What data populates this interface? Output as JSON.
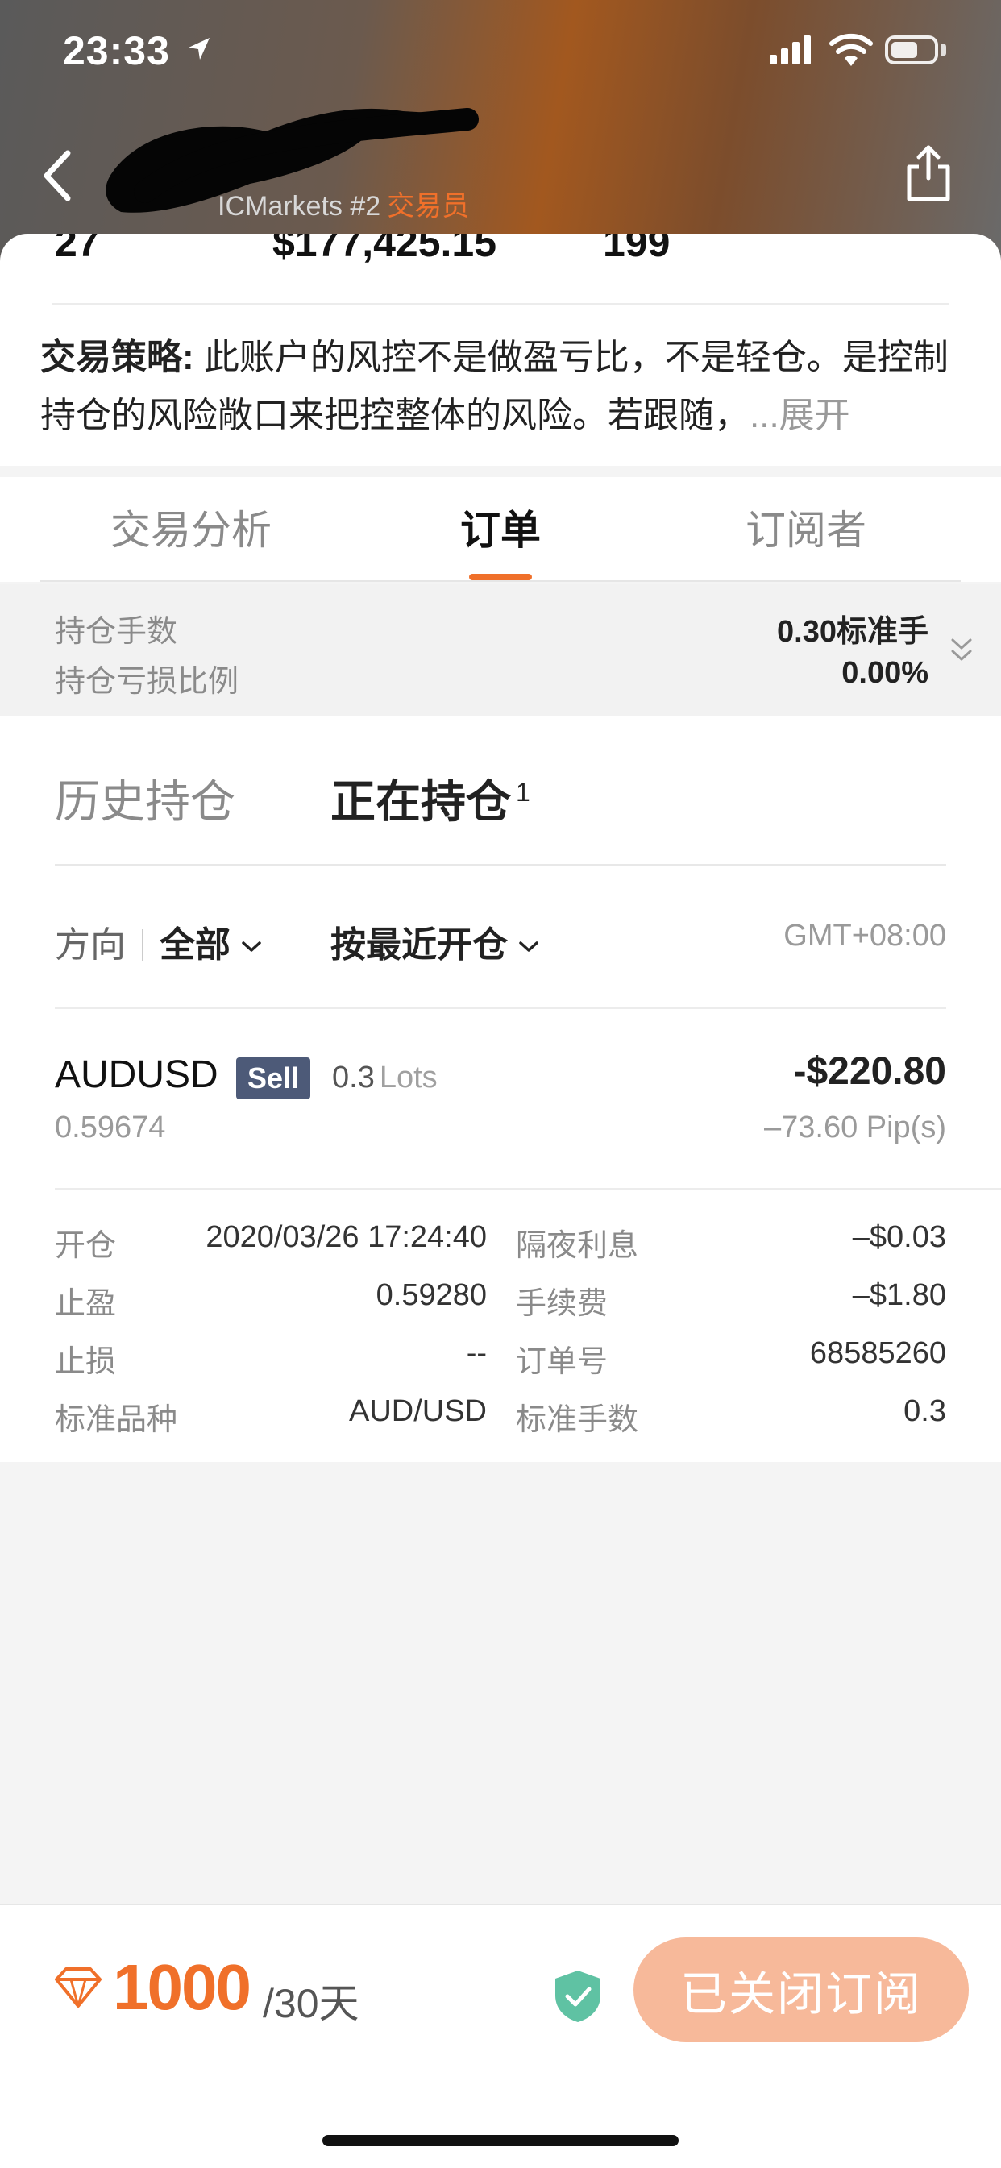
{
  "status_bar": {
    "time": "23:33"
  },
  "header": {
    "broker_name": "ICMarkets #2",
    "trader_tag": "交易员"
  },
  "stats": {
    "value_1": "27",
    "value_2": "$177,425.15",
    "value_3": "199"
  },
  "strategy": {
    "label": "交易策略:",
    "text": " 此账户的风控不是做盈亏比，不是轻仓。是控制持仓的风险敞口来把控整体的风险。若跟随，",
    "expand": "...展开"
  },
  "tabs": [
    {
      "label": "交易分析"
    },
    {
      "label": "订单"
    },
    {
      "label": "订阅者"
    }
  ],
  "summary": {
    "lots_label": "持仓手数",
    "lots_value": "0.30标准手",
    "loss_ratio_label": "持仓亏损比例",
    "loss_ratio_value": "0.00%"
  },
  "position_tabs": {
    "history": "历史持仓",
    "open": "正在持仓",
    "open_count": "1"
  },
  "filters": {
    "direction_label": "方向",
    "direction_value": "全部",
    "sort_label": "按最近开仓",
    "timezone": "GMT+08:00"
  },
  "order": {
    "symbol": "AUDUSD",
    "side": "Sell",
    "lots": "0.3",
    "lots_unit": "Lots",
    "pnl": "-$220.80",
    "open_price": "0.59674",
    "pips": "–73.60 Pip(s)",
    "details": [
      {
        "label": "开仓",
        "value": "2020/03/26 17:24:40"
      },
      {
        "label": "止盈",
        "value": "0.59280"
      },
      {
        "label": "止损",
        "value": "--"
      },
      {
        "label": "标准品种",
        "value": "AUD/USD"
      },
      {
        "label": "隔夜利息",
        "value": "–$0.03"
      },
      {
        "label": "手续费",
        "value": "–$1.80"
      },
      {
        "label": "订单号",
        "value": "68585260"
      },
      {
        "label": "标准手数",
        "value": "0.3"
      }
    ]
  },
  "bottom_bar": {
    "price": "1000",
    "period": "/30天",
    "button_label": "已关闭订阅"
  },
  "colors": {
    "accent": "#f0702a",
    "sell_badge": "#4d5a78",
    "button_disabled": "#f7b99a",
    "shield": "#5fc2a3"
  }
}
